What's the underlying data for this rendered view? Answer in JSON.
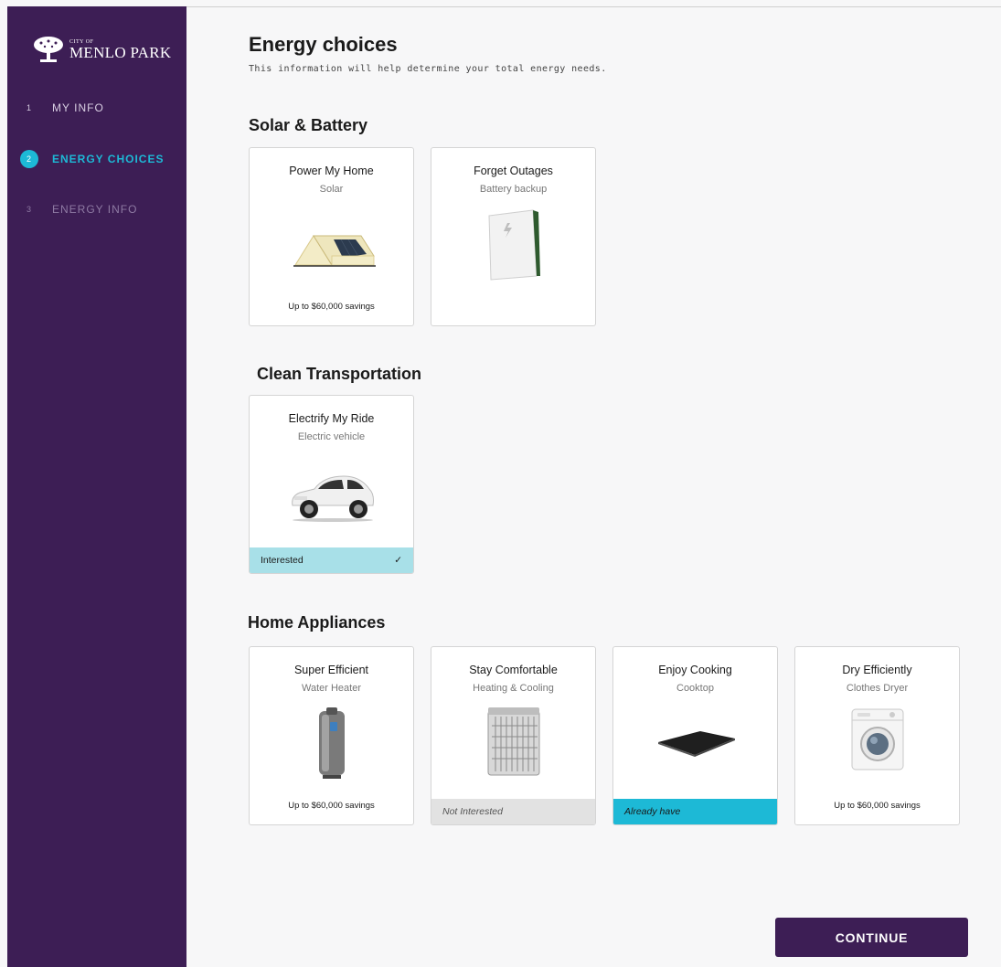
{
  "sidebar": {
    "logo": {
      "small": "CITY OF",
      "big": "MENLO PARK"
    },
    "steps": [
      {
        "num": "1",
        "label": "MY INFO"
      },
      {
        "num": "2",
        "label": "ENERGY CHOICES"
      },
      {
        "num": "3",
        "label": "ENERGY INFO"
      }
    ]
  },
  "page": {
    "title": "Energy choices",
    "subtitle": "This information will help determine your total energy needs."
  },
  "sections": {
    "solar": {
      "title": "Solar & Battery",
      "cards": [
        {
          "title": "Power My Home",
          "subtitle": "Solar",
          "footer": "Up to $60,000 savings"
        },
        {
          "title": "Forget Outages",
          "subtitle": "Battery backup"
        }
      ]
    },
    "transport": {
      "title": "Clean Transportation",
      "cards": [
        {
          "title": "Electrify My Ride",
          "subtitle": "Electric vehicle",
          "status": "Interested"
        }
      ]
    },
    "appliances": {
      "title": "Home Appliances",
      "cards": [
        {
          "title": "Super Efficient",
          "subtitle": "Water Heater",
          "footer": "Up to $60,000 savings"
        },
        {
          "title": "Stay Comfortable",
          "subtitle": "Heating & Cooling",
          "status": "Not Interested"
        },
        {
          "title": "Enjoy Cooking",
          "subtitle": "Cooktop",
          "status": "Already have"
        },
        {
          "title": "Dry Efficiently",
          "subtitle": "Clothes Dryer",
          "footer": "Up to $60,000 savings"
        }
      ]
    }
  },
  "continue_label": "CONTINUE",
  "colors": {
    "sidebar": "#3d1e55",
    "accent": "#1db9d6",
    "interested": "#a8e0e8",
    "not_interested": "#e2e2e2"
  }
}
